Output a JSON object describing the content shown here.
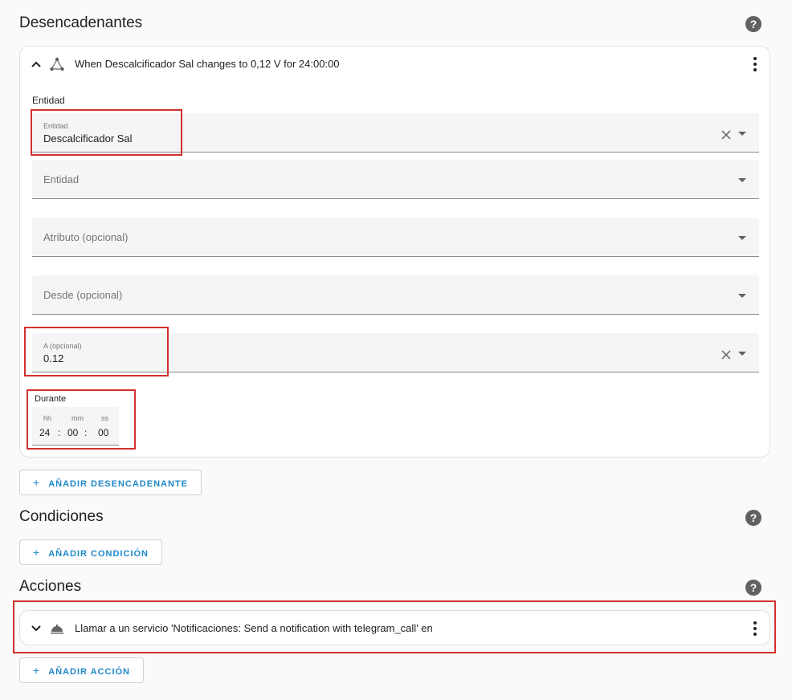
{
  "triggers": {
    "title": "Desencadenantes",
    "card": {
      "header": "When Descalcificador Sal changes to 0,12 V for 24:00:00",
      "entity_section_label": "Entidad",
      "entity_field": {
        "label": "Entidad",
        "value": "Descalcificador Sal"
      },
      "entity_field2": {
        "placeholder": "Entidad"
      },
      "attribute_field": {
        "placeholder": "Atributo (opcional)"
      },
      "from_field": {
        "placeholder": "Desde (opcional)"
      },
      "to_field": {
        "label": "A (opcional)",
        "value": "0.12"
      },
      "duration": {
        "label": "Durante",
        "hh_label": "hh",
        "mm_label": "mm",
        "ss_label": "ss",
        "hh": "24",
        "mm": "00",
        "ss": "00",
        "sep": ":"
      }
    },
    "add_button": "AÑADIR DESENCADENANTE"
  },
  "conditions": {
    "title": "Condiciones",
    "add_button": "AÑADIR CONDICIÓN"
  },
  "actions": {
    "title": "Acciones",
    "card_header": "Llamar a un servicio 'Notificaciones: Send a notification with telegram_call' en",
    "add_button": "AÑADIR ACCIÓN"
  },
  "icons": {
    "help": "?",
    "plus": "+"
  },
  "colors": {
    "accent": "#1e88c8",
    "highlight": "#d32f2f"
  }
}
